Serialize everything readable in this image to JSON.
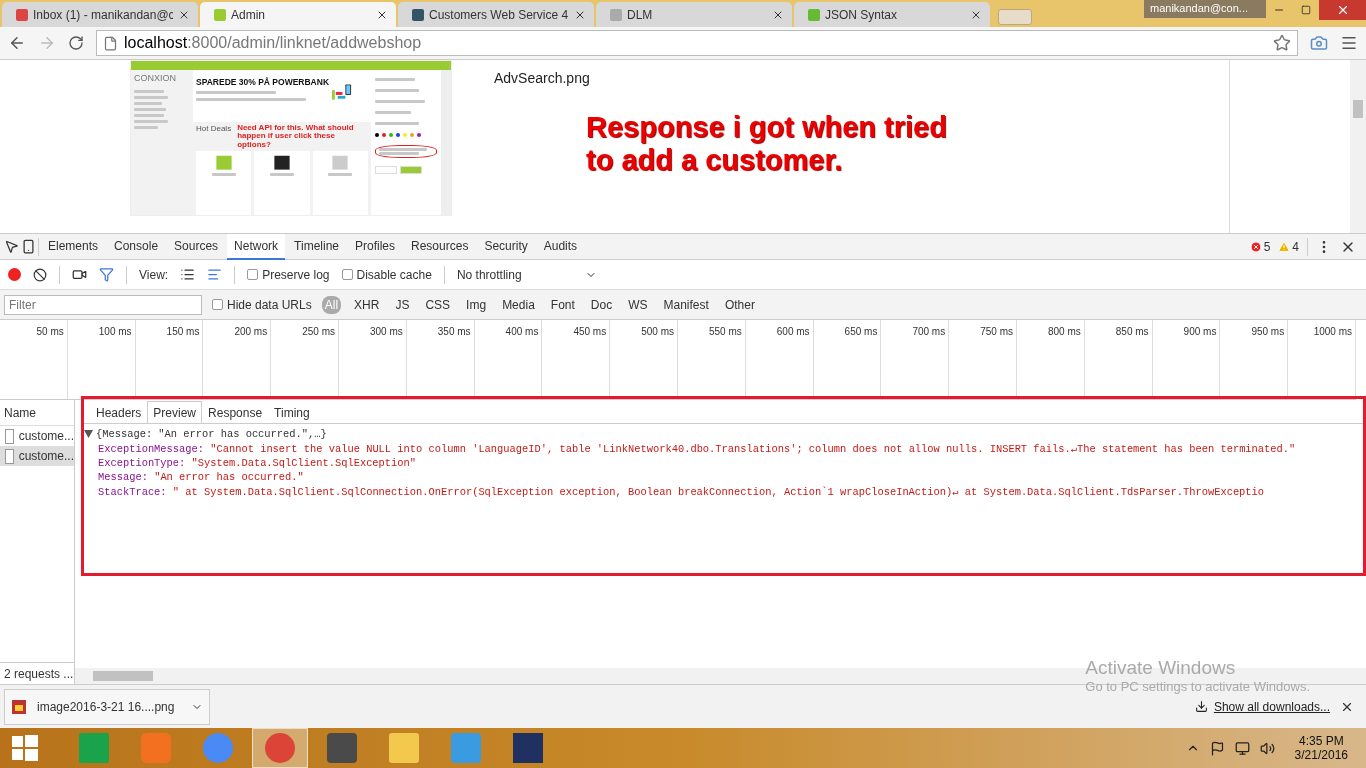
{
  "browser_tabs": [
    {
      "title": "Inbox (1) - manikandan@c",
      "kind": "mail",
      "selected": false
    },
    {
      "title": "Admin",
      "kind": "admin",
      "selected": true
    },
    {
      "title": "Customers Web Service 4",
      "kind": "tool",
      "selected": false
    },
    {
      "title": "DLM",
      "kind": "doc",
      "selected": false
    },
    {
      "title": "JSON Syntax",
      "kind": "w3",
      "selected": false
    }
  ],
  "profile": "manikandan@con...",
  "address": {
    "host": "localhost",
    "path": ":8000/admin/linknet/addwebshop"
  },
  "page": {
    "mockup": {
      "brand": "CONXION",
      "banner_title": "SPAREDE 30% PÅ POWERBANK",
      "section": "Hot Deals",
      "swatches": [
        {
          "color": "#000000"
        },
        {
          "color": "#e02020"
        },
        {
          "color": "#20c020"
        },
        {
          "color": "#2040e0"
        },
        {
          "color": "#f0f020"
        },
        {
          "color": "#f0a020"
        },
        {
          "color": "#9020c0"
        }
      ],
      "annotation": "Need API for this. What should happen if user click these options?"
    },
    "filename": "AdvSearch.png",
    "note": "Response i got when tried to add a customer."
  },
  "devtools": {
    "tabs": [
      {
        "label": "Elements",
        "selected": false
      },
      {
        "label": "Console",
        "selected": false
      },
      {
        "label": "Sources",
        "selected": false
      },
      {
        "label": "Network",
        "selected": true
      },
      {
        "label": "Timeline",
        "selected": false
      },
      {
        "label": "Profiles",
        "selected": false
      },
      {
        "label": "Resources",
        "selected": false
      },
      {
        "label": "Security",
        "selected": false
      },
      {
        "label": "Audits",
        "selected": false
      }
    ],
    "errors": "5",
    "warnings": "4",
    "view_label": "View:",
    "preserve_log": {
      "label": "Preserve log",
      "checked": false
    },
    "disable_cache": {
      "label": "Disable cache",
      "checked": false
    },
    "throttling": "No throttling",
    "filter": {
      "placeholder": "Filter"
    },
    "hide_data_urls": {
      "label": "Hide data URLs",
      "checked": false
    },
    "types": [
      {
        "label": "All",
        "selected": true
      },
      {
        "label": "XHR",
        "selected": false
      },
      {
        "label": "JS",
        "selected": false
      },
      {
        "label": "CSS",
        "selected": false
      },
      {
        "label": "Img",
        "selected": false
      },
      {
        "label": "Media",
        "selected": false
      },
      {
        "label": "Font",
        "selected": false
      },
      {
        "label": "Doc",
        "selected": false
      },
      {
        "label": "WS",
        "selected": false
      },
      {
        "label": "Manifest",
        "selected": false
      },
      {
        "label": "Other",
        "selected": false
      }
    ],
    "ticks": [
      "50 ms",
      "100 ms",
      "150 ms",
      "200 ms",
      "250 ms",
      "300 ms",
      "350 ms",
      "400 ms",
      "450 ms",
      "500 ms",
      "550 ms",
      "600 ms",
      "650 ms",
      "700 ms",
      "750 ms",
      "800 ms",
      "850 ms",
      "900 ms",
      "950 ms",
      "1000 ms"
    ],
    "name_header": "Name",
    "requests": [
      {
        "name": "custome...",
        "selected": false
      },
      {
        "name": "custome...",
        "selected": true
      }
    ],
    "summary": "2 requests ...",
    "detail_tabs": [
      {
        "label": "Headers",
        "selected": false
      },
      {
        "label": "Preview",
        "selected": true
      },
      {
        "label": "Response",
        "selected": false
      },
      {
        "label": "Timing",
        "selected": false
      }
    ],
    "preview": {
      "summary": "{Message: \"An error has occurred.\",…}",
      "expanded": true,
      "fields": [
        {
          "key": "ExceptionMessage:",
          "value": "\"Cannot insert the value NULL into column 'LanguageID', table 'LinkNetwork40.dbo.Translations'; column does not allow nulls. INSERT fails.↵The statement has been terminated.\""
        },
        {
          "key": "ExceptionType:",
          "value": "\"System.Data.SqlClient.SqlException\""
        },
        {
          "key": "Message:",
          "value": "\"An error has occurred.\""
        },
        {
          "key": "StackTrace:",
          "value": "\"   at System.Data.SqlClient.SqlConnection.OnError(SqlException exception, Boolean breakConnection, Action`1 wrapCloseInAction)↵   at System.Data.SqlClient.TdsParser.ThrowExceptio"
        }
      ]
    }
  },
  "watermark": {
    "title": "Activate Windows",
    "subtitle": "Go to PC settings to activate Windows."
  },
  "download": {
    "file": "image2016-3-21 16....png",
    "show_all": "Show all downloads..."
  },
  "taskbar": {
    "apps": [
      {
        "kind": "store",
        "selected": false
      },
      {
        "kind": "xampp",
        "selected": false
      },
      {
        "kind": "chrome-user",
        "selected": false
      },
      {
        "kind": "chrome",
        "selected": true
      },
      {
        "kind": "sublime",
        "selected": false
      },
      {
        "kind": "folder",
        "selected": false
      },
      {
        "kind": "diamond",
        "selected": false
      },
      {
        "kind": "snip",
        "selected": false
      }
    ],
    "time": "4:35 PM",
    "date": "3/21/2016"
  }
}
